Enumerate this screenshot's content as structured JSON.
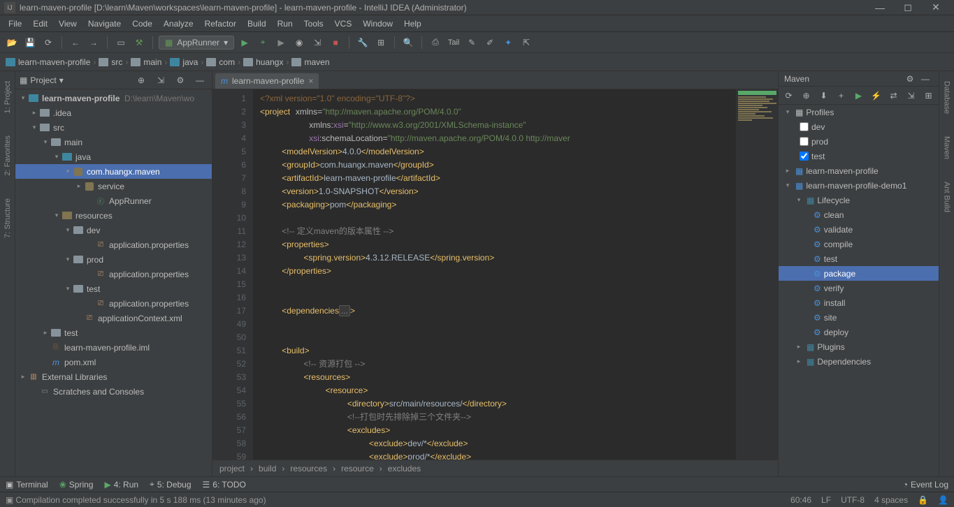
{
  "window": {
    "title": "learn-maven-profile [D:\\learn\\Maven\\workspaces\\learn-maven-profile] - learn-maven-profile - IntelliJ IDEA (Administrator)"
  },
  "menubar": [
    "File",
    "Edit",
    "View",
    "Navigate",
    "Code",
    "Analyze",
    "Refactor",
    "Build",
    "Run",
    "Tools",
    "VCS",
    "Window",
    "Help"
  ],
  "toolbar": {
    "run_config": "AppRunner",
    "tail": "Tail"
  },
  "breadcrumbs": [
    "learn-maven-profile",
    "src",
    "main",
    "java",
    "com",
    "huangx",
    "maven"
  ],
  "project_panel": {
    "title": "Project",
    "root": "learn-maven-profile",
    "root_hint": "D:\\learn\\Maven\\wo",
    "tree": {
      "idea": ".idea",
      "src": "src",
      "main": "main",
      "java": "java",
      "package": "com.huangx.maven",
      "service": "service",
      "apprunner": "AppRunner",
      "resources": "resources",
      "dev": "dev",
      "app_props": "application.properties",
      "prod": "prod",
      "test_folder": "test",
      "app_context": "applicationContext.xml",
      "test": "test",
      "iml": "learn-maven-profile.iml",
      "pom": "pom.xml",
      "ext_libs": "External Libraries",
      "scratches": "Scratches and Consoles"
    }
  },
  "left_tools": [
    "1: Project",
    "2: Favorites",
    "7: Structure"
  ],
  "right_tools": [
    "Database",
    "Maven",
    "Ant Build"
  ],
  "editor": {
    "tab": "learn-maven-profile",
    "line_numbers": [
      "1",
      "2",
      "3",
      "4",
      "5",
      "6",
      "7",
      "8",
      "9",
      "10",
      "11",
      "12",
      "13",
      "14",
      "15",
      "16",
      "17",
      "49",
      "50",
      "51",
      "52",
      "53",
      "54",
      "55",
      "56",
      "57",
      "58",
      "59"
    ],
    "crumbs": [
      "project",
      "build",
      "resources",
      "resource",
      "excludes"
    ]
  },
  "code": {
    "pi": "<?xml version=\"1.0\" encoding=\"UTF-8\"?>",
    "ns1": "\"http://maven.apache.org/POM/4.0.0\"",
    "ns2": "\"http://www.w3.org/2001/XMLSchema-instance\"",
    "ns3_a": "\"http://maven.apache.org/POM/4.0.0 ",
    "ns3_b": "http://maver",
    "model": "4.0.0",
    "group": "com.huangx.maven",
    "artifact": "learn-maven-profile",
    "version": "1.0-SNAPSHOT",
    "packaging": "pom",
    "cmt1": "<!-- 定义maven的版本属性 -->",
    "spring": "4.3.12.RELEASE",
    "cmt2": "<!-- 资源打包 -->",
    "dir": "src/main/resources/",
    "cmt3": "<!--打包时先排除掉三个文件夹-->",
    "ex1": "dev/*",
    "ex2": "prod/*"
  },
  "maven": {
    "title": "Maven",
    "profiles": "Profiles",
    "dev": "dev",
    "prod": "prod",
    "test": "test",
    "proj1": "learn-maven-profile",
    "proj2": "learn-maven-profile-demo1",
    "lifecycle": "Lifecycle",
    "goals": [
      "clean",
      "validate",
      "compile",
      "test",
      "package",
      "verify",
      "install",
      "site",
      "deploy"
    ],
    "plugins": "Plugins",
    "deps": "Dependencies"
  },
  "bottom": {
    "terminal": "Terminal",
    "spring": "Spring",
    "run": "4: Run",
    "debug": "5: Debug",
    "todo": "6: TODO",
    "eventlog": "Event Log"
  },
  "status": {
    "msg": "Compilation completed successfully in 5 s 188 ms (13 minutes ago)",
    "pos": "60:46",
    "le": "LF",
    "enc": "UTF-8",
    "indent": "4 spaces"
  }
}
